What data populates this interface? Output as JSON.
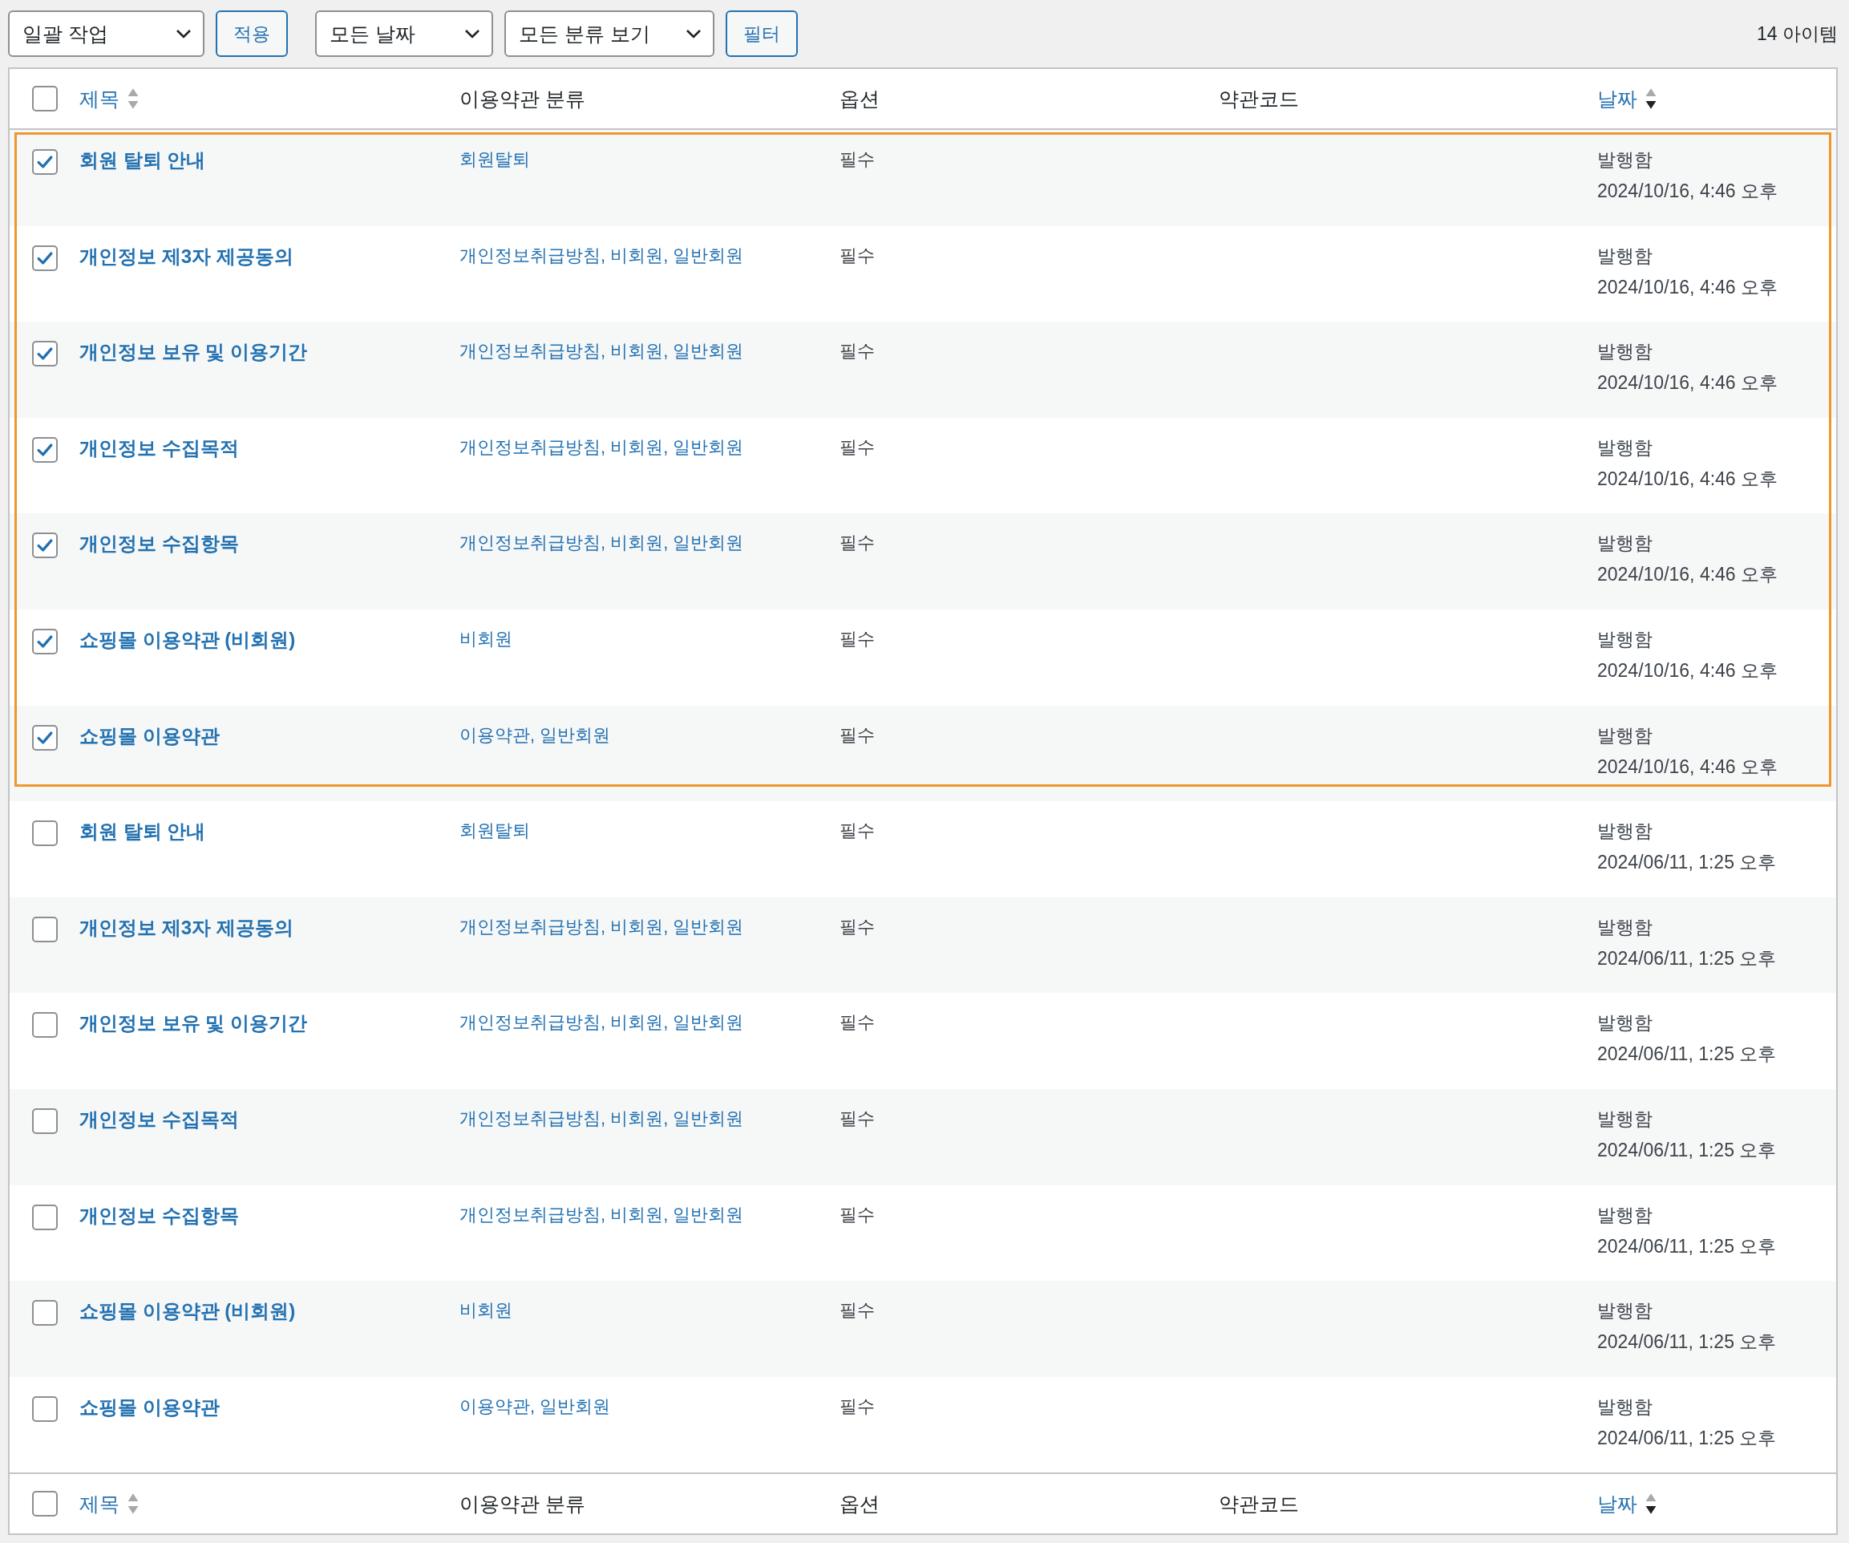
{
  "toolbar": {
    "bulk_action": {
      "value": "일괄 작업"
    },
    "apply_button": "적용",
    "date_filter": {
      "value": "모든 날짜"
    },
    "category_filter": {
      "value": "모든 분류 보기"
    },
    "filter_button": "필터",
    "item_count": "14 아이템"
  },
  "header": {
    "select_all": {
      "checked": false
    },
    "columns": [
      {
        "label": "제목",
        "sortable": true,
        "sorted_desc": false
      },
      {
        "label": "이용약관 분류",
        "sortable": false
      },
      {
        "label": "옵션",
        "sortable": false
      },
      {
        "label": "약관코드",
        "sortable": false
      },
      {
        "label": "날짜",
        "sortable": true,
        "sorted_desc": true
      }
    ]
  },
  "row_groups": [
    {
      "highlighted": true,
      "rows": [
        {
          "checked": true,
          "title": "회원 탈퇴 안내",
          "categories": "회원탈퇴",
          "option": "필수",
          "status": "발행함",
          "date": "2024/10/16, 4:46 오후"
        },
        {
          "checked": true,
          "title": "개인정보 제3자 제공동의",
          "categories": "개인정보취급방침, 비회원, 일반회원",
          "option": "필수",
          "status": "발행함",
          "date": "2024/10/16, 4:46 오후"
        },
        {
          "checked": true,
          "title": "개인정보 보유 및 이용기간",
          "categories": "개인정보취급방침, 비회원, 일반회원",
          "option": "필수",
          "status": "발행함",
          "date": "2024/10/16, 4:46 오후"
        },
        {
          "checked": true,
          "title": "개인정보 수집목적",
          "categories": "개인정보취급방침, 비회원, 일반회원",
          "option": "필수",
          "status": "발행함",
          "date": "2024/10/16, 4:46 오후"
        },
        {
          "checked": true,
          "title": "개인정보 수집항목",
          "categories": "개인정보취급방침, 비회원, 일반회원",
          "option": "필수",
          "status": "발행함",
          "date": "2024/10/16, 4:46 오후"
        },
        {
          "checked": true,
          "title": "쇼핑몰 이용약관 (비회원)",
          "categories": "비회원",
          "option": "필수",
          "status": "발행함",
          "date": "2024/10/16, 4:46 오후"
        },
        {
          "checked": true,
          "title": "쇼핑몰 이용약관",
          "categories": "이용약관, 일반회원",
          "option": "필수",
          "status": "발행함",
          "date": "2024/10/16, 4:46 오후"
        }
      ]
    },
    {
      "highlighted": false,
      "rows": [
        {
          "checked": false,
          "title": "회원 탈퇴 안내",
          "categories": "회원탈퇴",
          "option": "필수",
          "status": "발행함",
          "date": "2024/06/11, 1:25 오후"
        },
        {
          "checked": false,
          "title": "개인정보 제3자 제공동의",
          "categories": "개인정보취급방침, 비회원, 일반회원",
          "option": "필수",
          "status": "발행함",
          "date": "2024/06/11, 1:25 오후"
        },
        {
          "checked": false,
          "title": "개인정보 보유 및 이용기간",
          "categories": "개인정보취급방침, 비회원, 일반회원",
          "option": "필수",
          "status": "발행함",
          "date": "2024/06/11, 1:25 오후"
        },
        {
          "checked": false,
          "title": "개인정보 수집목적",
          "categories": "개인정보취급방침, 비회원, 일반회원",
          "option": "필수",
          "status": "발행함",
          "date": "2024/06/11, 1:25 오후"
        },
        {
          "checked": false,
          "title": "개인정보 수집항목",
          "categories": "개인정보취급방침, 비회원, 일반회원",
          "option": "필수",
          "status": "발행함",
          "date": "2024/06/11, 1:25 오후"
        },
        {
          "checked": false,
          "title": "쇼핑몰 이용약관 (비회원)",
          "categories": "비회원",
          "option": "필수",
          "status": "발행함",
          "date": "2024/06/11, 1:25 오후"
        },
        {
          "checked": false,
          "title": "쇼핑몰 이용약관",
          "categories": "이용약관, 일반회원",
          "option": "필수",
          "status": "발행함",
          "date": "2024/06/11, 1:25 오후"
        }
      ]
    }
  ],
  "footer": {
    "select_all": {
      "checked": false
    },
    "columns": [
      {
        "label": "제목",
        "sortable": true,
        "sorted_desc": false
      },
      {
        "label": "이용약관 분류",
        "sortable": false
      },
      {
        "label": "옵션",
        "sortable": false
      },
      {
        "label": "약관코드",
        "sortable": false
      },
      {
        "label": "날짜",
        "sortable": true,
        "sorted_desc": true
      }
    ]
  }
}
